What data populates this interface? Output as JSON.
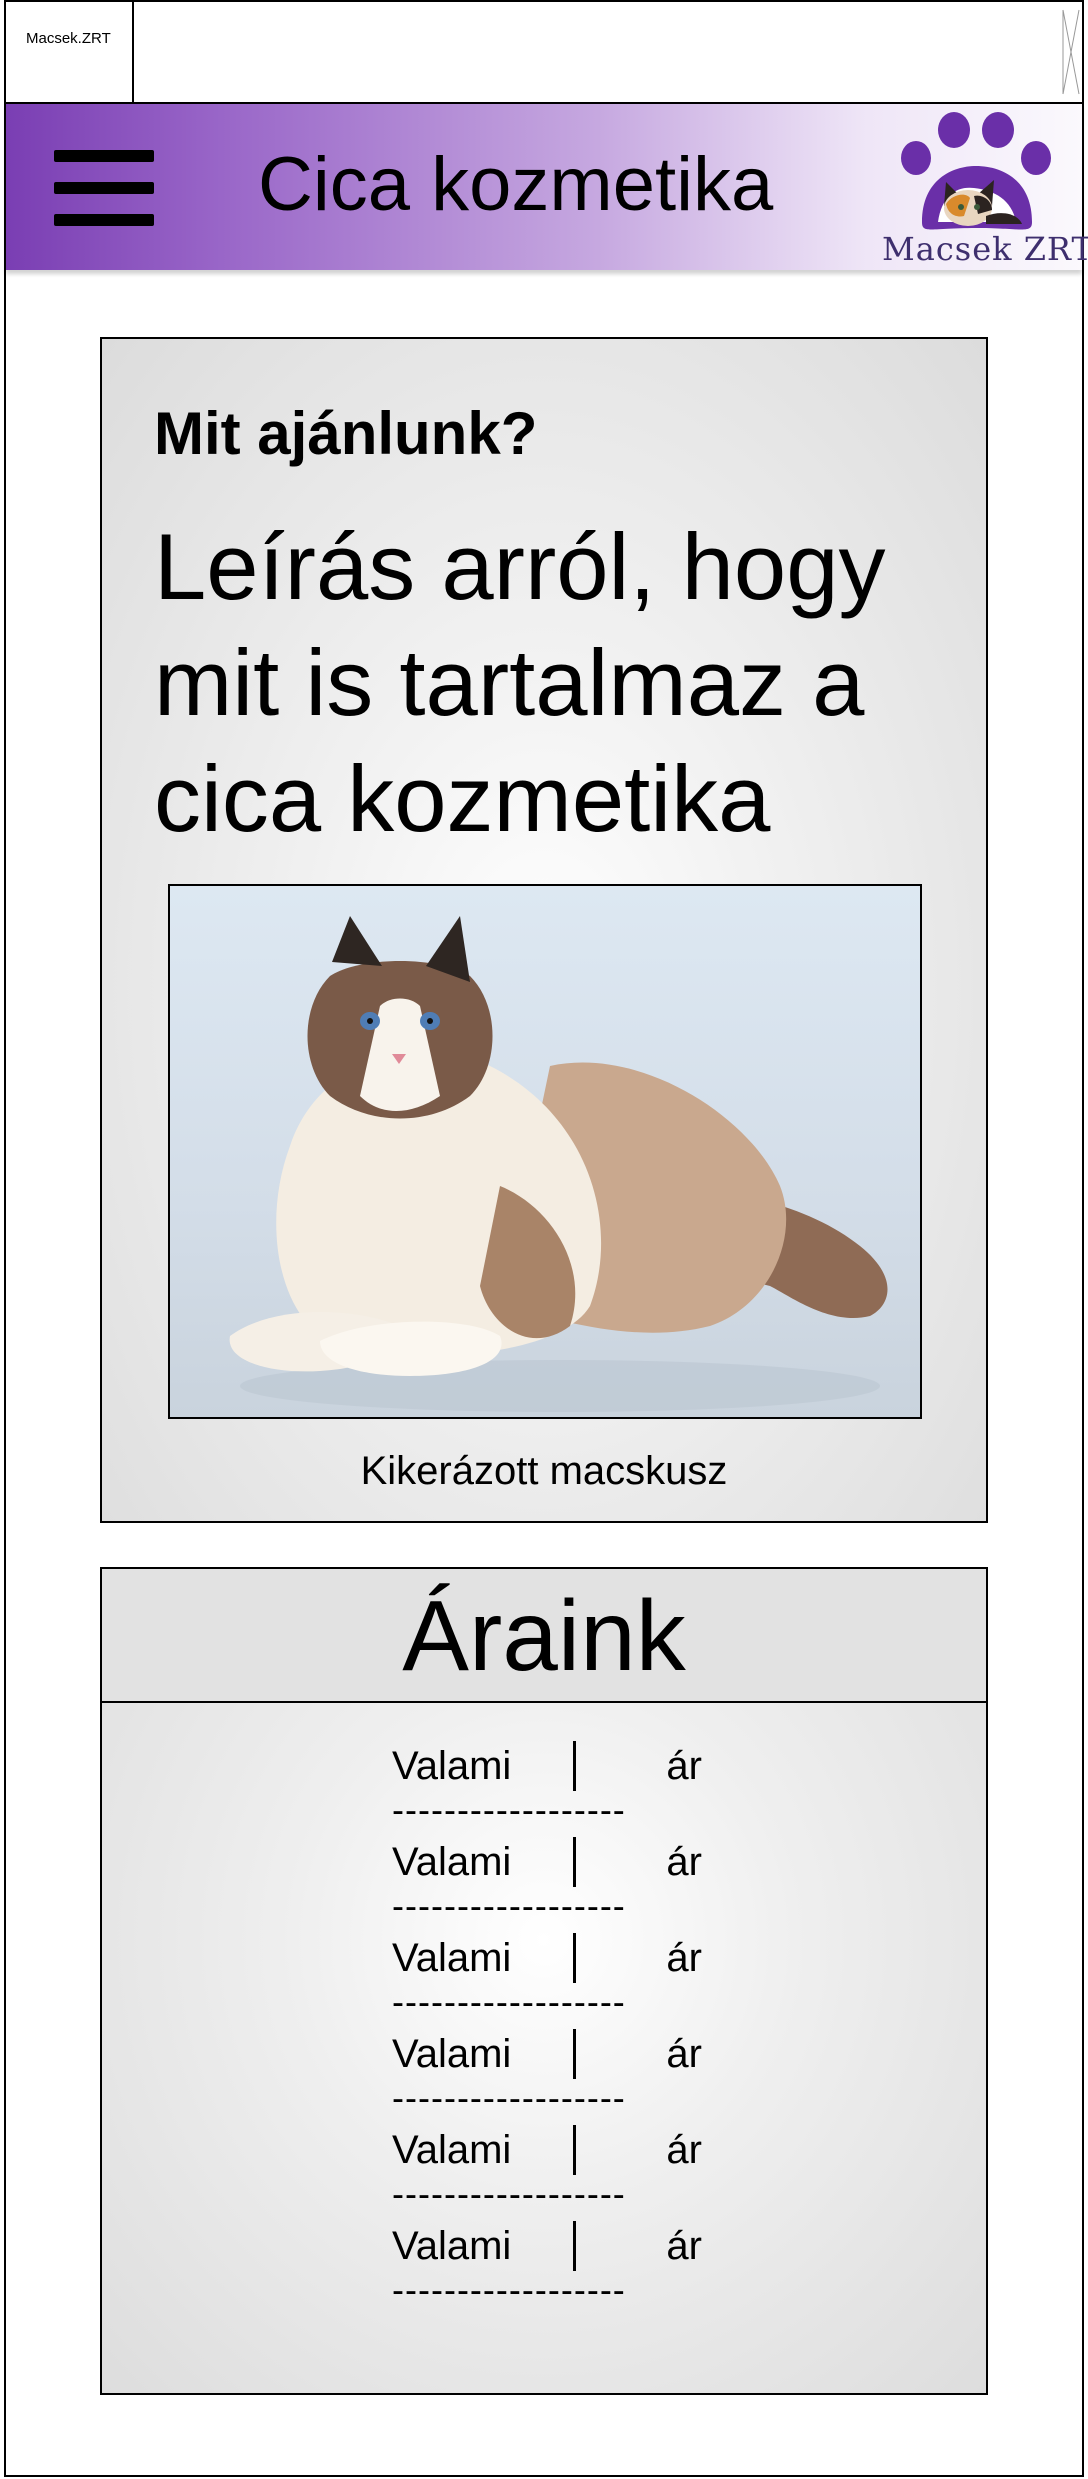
{
  "browser": {
    "tab_label": "Macsek.ZRT"
  },
  "header": {
    "title": "Cica kozmetika",
    "brand_name": "Macsek ZRT"
  },
  "offer": {
    "heading": "Mit ajánlunk?",
    "description": "Leírás arról, hogy mit is tartalmaz a cica kozmetika",
    "image_caption": "Kikerázott macskusz"
  },
  "prices": {
    "title": "Áraink",
    "rows": [
      {
        "item": "Valami",
        "price": "ár",
        "separator": "------------------"
      },
      {
        "item": "Valami",
        "price": "ár",
        "separator": "------------------"
      },
      {
        "item": "Valami",
        "price": "ár",
        "separator": "------------------"
      },
      {
        "item": "Valami",
        "price": "ár",
        "separator": "------------------"
      },
      {
        "item": "Valami",
        "price": "ár",
        "separator": "------------------"
      },
      {
        "item": "Valami",
        "price": "ár",
        "separator": "------------------"
      }
    ]
  },
  "colors": {
    "header_start": "#7a3eb3",
    "header_end": "#fbf9fd",
    "brand_purple": "#6a2fa8"
  },
  "icons": [
    "menu-icon",
    "paw-logo-icon",
    "close-icon"
  ]
}
